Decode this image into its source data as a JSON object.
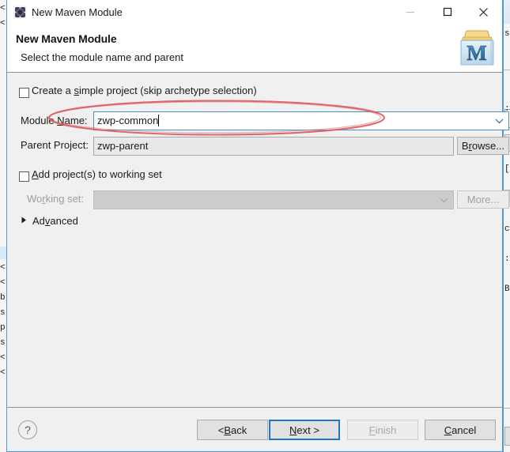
{
  "window": {
    "title": "New Maven Module",
    "titlebar_icon": "maven-gear-icon",
    "minimize_label": "minimize-icon",
    "maximize_label": "maximize-icon",
    "close_label": "close-icon"
  },
  "header": {
    "title": "New Maven Module",
    "subtitle": "Select the module name and parent",
    "icon": "maven-module-folder-icon",
    "icon_letter": "M"
  },
  "form": {
    "simple_project": {
      "label_before": "Create a ",
      "label_mnemonic": "s",
      "label_after": "imple project (skip archetype selection)",
      "checked": false
    },
    "module_name": {
      "label_before": "Module ",
      "label_mnemonic": "N",
      "label_after": "ame:",
      "value": "zwp-common",
      "placeholder": "",
      "focused": true,
      "combo_arrow": "chevron-down-icon"
    },
    "parent_project": {
      "label": "Parent Project:",
      "value": "zwp-parent",
      "placeholder": "",
      "browse_label_before": "B",
      "browse_label_mnemonic": "r",
      "browse_label_after": "owse..."
    },
    "working_set_checkbox": {
      "label_mnemonic": "A",
      "label_after": "dd project(s) to working set",
      "checked": false
    },
    "working_set": {
      "label_before": "Wo",
      "label_mnemonic": "r",
      "label_after": "king set:",
      "value": "",
      "disabled": true,
      "more_label_before": "More...",
      "combo_arrow": "chevron-down-icon"
    },
    "advanced": {
      "label_before": "Ad",
      "label_mnemonic": "v",
      "label_after": "anced",
      "expanded": false,
      "twisty_icon": "triangle-right-icon"
    }
  },
  "footer": {
    "help_icon": "question-mark-icon",
    "buttons": [
      {
        "label_before": "< ",
        "label_mnemonic": "B",
        "label_after": "ack",
        "state": "enabled"
      },
      {
        "label_before": "",
        "label_mnemonic": "N",
        "label_after": "ext >",
        "state": "default"
      },
      {
        "label_before": "",
        "label_mnemonic": "F",
        "label_after": "inish",
        "state": "disabled"
      },
      {
        "label_before": "",
        "label_mnemonic": "C",
        "label_after": "ancel",
        "state": "enabled"
      }
    ]
  },
  "annotation": {
    "type": "hand-drawn-ellipse",
    "color": "#e05a5a",
    "target": "module-name-row"
  },
  "background": {
    "left_code_sliver": "<\n<\nb\ns\np\ns\n<\n<",
    "left_top_sliver": "<\n<",
    "right_code_sliver": "s\n \n \n \n \n:\n(\n \n \n[\n \n \n \nc\n \n:\n \nB"
  },
  "colors": {
    "window_border": "#4b9ad4",
    "dialog_bg": "#f0f0f0",
    "header_bg": "#ffffff",
    "focus_border": "#4a90c4",
    "default_button_border": "#1f74c4",
    "annotation_red": "#e05a5a",
    "maven_blue": "#2e6da4"
  }
}
